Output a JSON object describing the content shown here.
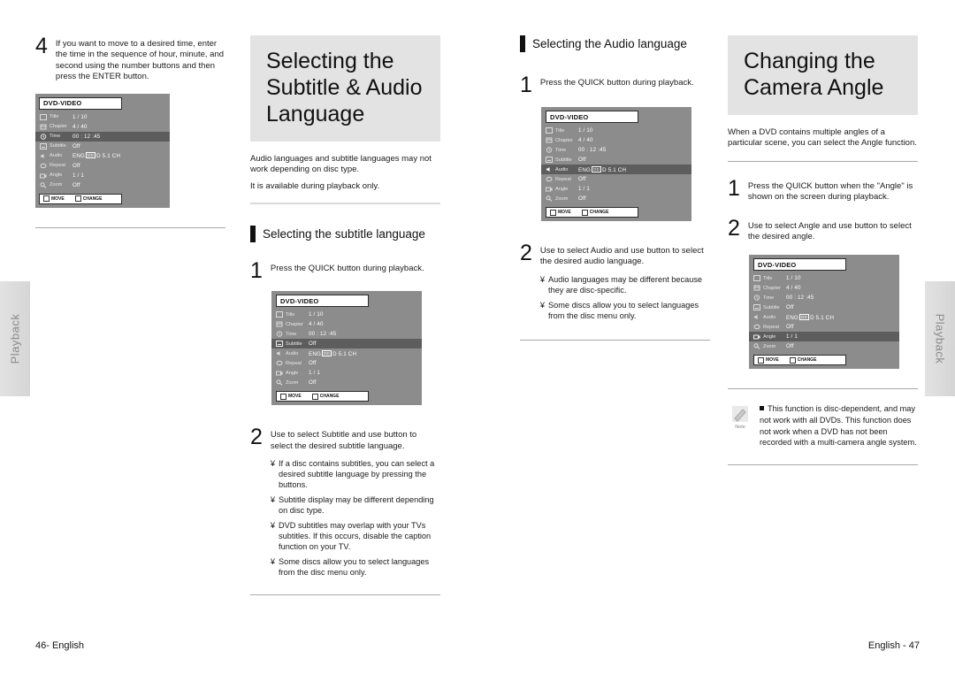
{
  "side_tabs": {
    "left_label": "Playback",
    "right_label": "Playback"
  },
  "footer": {
    "left": "46- English",
    "right": "English - 47"
  },
  "osd_common": {
    "title": "DVD-VIDEO",
    "labels": {
      "title": "Title",
      "chapter": "Chapter",
      "time": "Time",
      "subtitle": "Subtitle",
      "audio": "Audio",
      "repeat": "Repeat",
      "angle": "Angle",
      "zoom": "Zoom"
    },
    "values": {
      "title": "1 / 10",
      "chapter": "4 / 40",
      "time": "00 : 12 :45",
      "subtitle": "Off",
      "audio_pre": "ENG",
      "audio_dd": "DD",
      "audio_post": "D 5.1 CH",
      "repeat": "Off",
      "angle": "1 / 1",
      "zoom": "Off"
    },
    "bottom": {
      "move": "MOVE",
      "change": "CHANGE"
    }
  },
  "col_left": {
    "step4": {
      "number": "4",
      "text": "If you want to move to a desired time, enter the time in the sequence of hour, minute, and second using the number buttons and then press the ENTER button."
    },
    "osd_highlight": "time"
  },
  "col_two": {
    "heading": "Selecting the Subtitle & Audio Language",
    "intro_1": "Audio languages and subtitle languages may not work depending on disc type.",
    "intro_2": "It is available during playback only.",
    "section": "Selecting the subtitle language",
    "step1": {
      "number": "1",
      "text": "Press the QUICK button during playback."
    },
    "osd_highlight": "subtitle",
    "step2": {
      "number": "2",
      "text": "Use         to select Subtitle and use          button to select the desired subtitle language.",
      "notes": [
        "If a disc contains subtitles, you can select a desired subtitle language by pressing the        buttons.",
        "Subtitle display may be different depending on disc type.",
        "DVD subtitles may overlap with your TVs subtitles. If this occurs, disable the caption function on your TV.",
        "Some discs allow you to select languages from the disc menu only."
      ],
      "note_marker": "¥"
    }
  },
  "col_three": {
    "section": "Selecting the Audio language",
    "step1": {
      "number": "1",
      "text": "Press the QUICK button during playback."
    },
    "osd_highlight": "audio",
    "step2": {
      "number": "2",
      "text": "Use         to select Audio and use          button to select the desired audio language.",
      "notes": [
        "Audio languages may be different because they are disc-specific.",
        "Some discs allow you to select languages from the disc menu only."
      ],
      "note_marker": "¥"
    }
  },
  "col_four": {
    "heading": "Changing the Camera Angle",
    "intro": "When a DVD contains multiple angles of a particular scene, you can select the Angle function.",
    "step1": {
      "number": "1",
      "text": "Press the QUICK button when the \"Angle\" is shown on the screen during playback."
    },
    "step2": {
      "number": "2",
      "text": "Use         to select Angle and use          button to select the desired angle."
    },
    "osd_highlight": "angle",
    "note": {
      "caption": "Note",
      "text": "This function is disc-dependent, and may not work with all DVDs. This function does not work when a DVD has not been recorded with a multi-camera angle system."
    }
  }
}
